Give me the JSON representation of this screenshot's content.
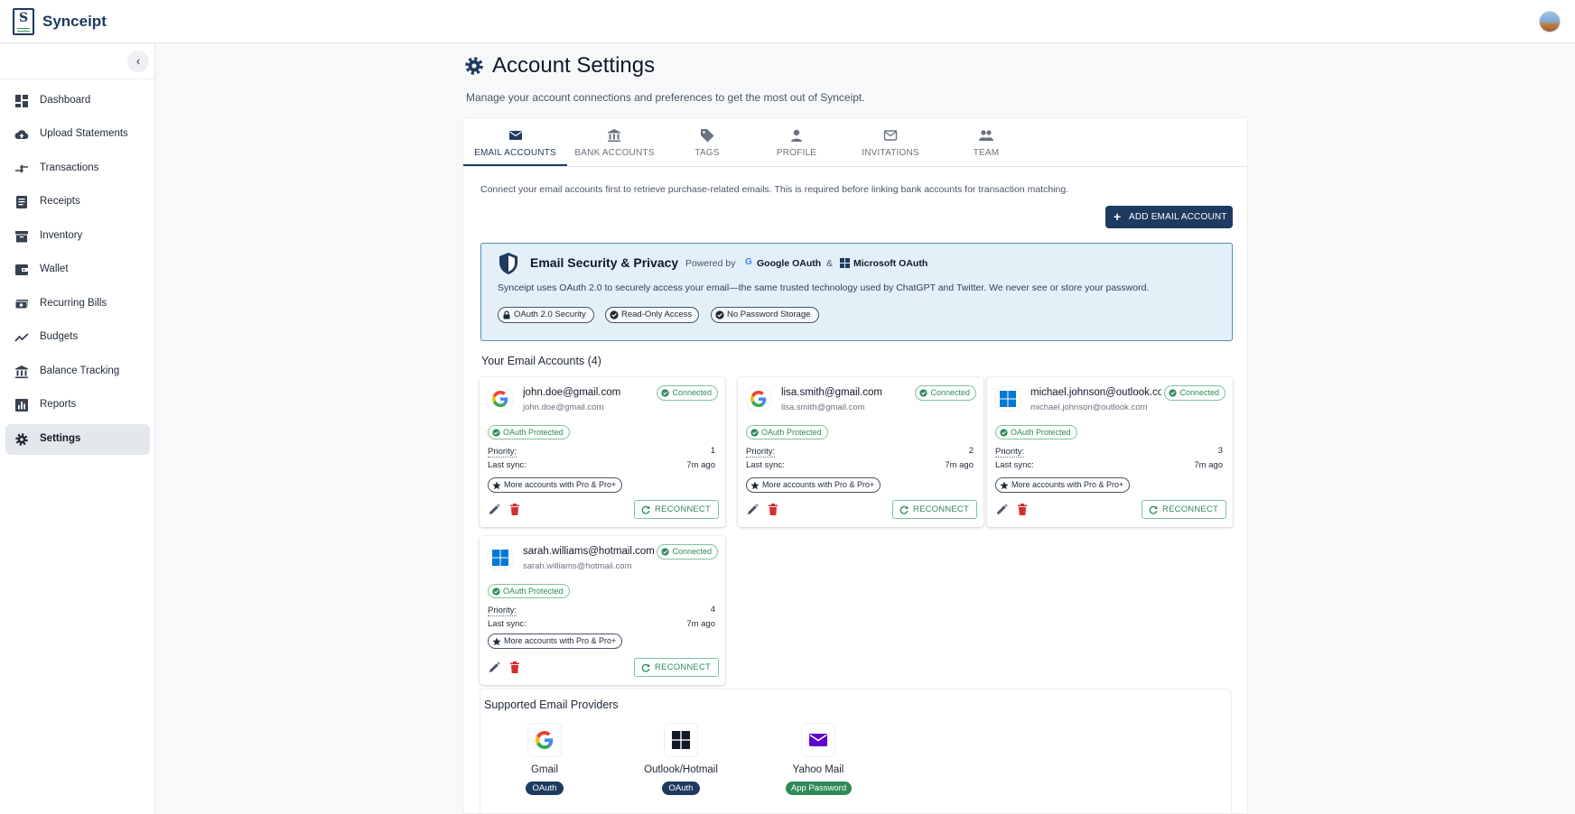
{
  "app": {
    "name": "Synceipt",
    "logo_letter": "S"
  },
  "sidebar": {
    "collapse_icon": "chevron-left-icon",
    "items": [
      {
        "label": "Dashboard",
        "icon": "dashboard-icon",
        "active": false
      },
      {
        "label": "Upload Statements",
        "icon": "cloud-upload-icon",
        "active": false
      },
      {
        "label": "Transactions",
        "icon": "swap-arrows-icon",
        "active": false
      },
      {
        "label": "Receipts",
        "icon": "receipt-icon",
        "active": false
      },
      {
        "label": "Inventory",
        "icon": "archive-box-icon",
        "active": false
      },
      {
        "label": "Wallet",
        "icon": "wallet-icon",
        "active": false
      },
      {
        "label": "Recurring Bills",
        "icon": "money-icon",
        "active": false
      },
      {
        "label": "Budgets",
        "icon": "trend-line-icon",
        "active": false
      },
      {
        "label": "Balance Tracking",
        "icon": "bank-icon",
        "active": false
      },
      {
        "label": "Reports",
        "icon": "bar-chart-icon",
        "active": false
      },
      {
        "label": "Settings",
        "icon": "gear-icon",
        "active": true
      }
    ]
  },
  "header": {
    "title": "Account Settings",
    "subtitle": "Manage your account connections and preferences to get the most out of Synceipt."
  },
  "tabs": [
    {
      "label": "EMAIL ACCOUNTS",
      "icon": "envelope-icon",
      "active": true
    },
    {
      "label": "BANK ACCOUNTS",
      "icon": "bank-icon",
      "active": false
    },
    {
      "label": "TAGS",
      "icon": "tag-icon",
      "active": false
    },
    {
      "label": "PROFILE",
      "icon": "person-icon",
      "active": false
    },
    {
      "label": "INVITATIONS",
      "icon": "envelope-outline-icon",
      "active": false
    },
    {
      "label": "TEAM",
      "icon": "people-icon",
      "active": false
    }
  ],
  "email_tab": {
    "intro": "Connect your email accounts first to retrieve purchase-related emails. This is required before linking bank accounts for transaction matching.",
    "add_button": "ADD EMAIL ACCOUNT",
    "security": {
      "title": "Email Security & Privacy",
      "powered_by": "Powered by",
      "google": "Google OAuth",
      "amp": "&",
      "microsoft": "Microsoft OAuth",
      "google_mark": "G",
      "description": "Synceipt uses OAuth 2.0 to securely access your email—the same trusted technology used by ChatGPT and Twitter. We never see or store your password.",
      "chips": [
        "OAuth 2.0 Security",
        "Read-Only Access",
        "No Password Storage"
      ]
    },
    "accounts_heading": "Your Email Accounts (4)",
    "labels": {
      "connected": "Connected",
      "oauth": "OAuth Protected",
      "priority": "Priority:",
      "last_sync": "Last sync:",
      "pro": "More accounts with Pro & Pro+",
      "reconnect": "RECONNECT"
    },
    "accounts": [
      {
        "name": "john.doe@gmail.com",
        "email": "john.doe@gmail.com",
        "provider": "google",
        "priority": "1",
        "last_sync": "7m ago"
      },
      {
        "name": "lisa.smith@gmail.com",
        "email": "lisa.smith@gmail.com",
        "provider": "google",
        "priority": "2",
        "last_sync": "7m ago"
      },
      {
        "name": "michael.johnson@outlook.com",
        "email": "michael.johnson@outlook.com",
        "provider": "microsoft",
        "priority": "3",
        "last_sync": "7m ago"
      },
      {
        "name": "sarah.williams@hotmail.com",
        "email": "sarah.williams@hotmail.com",
        "provider": "microsoft",
        "priority": "4",
        "last_sync": "7m ago"
      }
    ],
    "supported": {
      "title": "Supported Email Providers",
      "providers": [
        {
          "name": "Gmail",
          "badge": "OAuth",
          "badge_color": "#1e3a5f",
          "icon": "google-icon"
        },
        {
          "name": "Outlook/Hotmail",
          "badge": "OAuth",
          "badge_color": "#1e3a5f",
          "icon": "windows-icon"
        },
        {
          "name": "Yahoo Mail",
          "badge": "App Password",
          "badge_color": "#2e8b57",
          "icon": "mail-icon"
        }
      ]
    }
  },
  "colors": {
    "primary": "#1e3a5f",
    "success": "#2e8b57",
    "danger": "#d32f2f",
    "info_bg": "#e3f0f8"
  }
}
